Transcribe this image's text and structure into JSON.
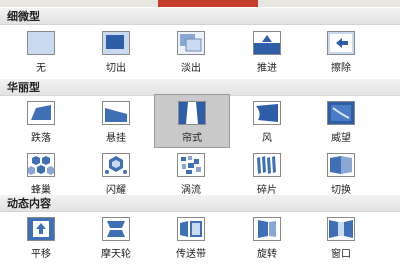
{
  "sections": [
    {
      "title": "细微型",
      "items": [
        {
          "label": "无",
          "icon": "none-transition-icon"
        },
        {
          "label": "切出",
          "icon": "cut-transition-icon"
        },
        {
          "label": "淡出",
          "icon": "fade-transition-icon"
        },
        {
          "label": "推进",
          "icon": "push-transition-icon"
        },
        {
          "label": "擦除",
          "icon": "wipe-transition-icon"
        }
      ]
    },
    {
      "title": "华丽型",
      "items": [
        {
          "label": "跌落",
          "icon": "fall-over-transition-icon"
        },
        {
          "label": "悬挂",
          "icon": "drape-transition-icon"
        },
        {
          "label": "帘式",
          "icon": "curtains-transition-icon",
          "selected": true
        },
        {
          "label": "风",
          "icon": "wind-transition-icon"
        },
        {
          "label": "威望",
          "icon": "prestige-transition-icon"
        },
        {
          "label": "蜂巢",
          "icon": "honeycomb-transition-icon"
        },
        {
          "label": "闪耀",
          "icon": "glitter-transition-icon"
        },
        {
          "label": "涡流",
          "icon": "vortex-transition-icon"
        },
        {
          "label": "碎片",
          "icon": "shred-transition-icon"
        },
        {
          "label": "切换",
          "icon": "switch-transition-icon"
        }
      ]
    },
    {
      "title": "动态内容",
      "items": [
        {
          "label": "平移",
          "icon": "pan-transition-icon"
        },
        {
          "label": "摩天轮",
          "icon": "ferris-wheel-transition-icon"
        },
        {
          "label": "传送带",
          "icon": "conveyor-transition-icon"
        },
        {
          "label": "旋转",
          "icon": "rotate-transition-icon"
        },
        {
          "label": "窗口",
          "icon": "window-transition-icon"
        }
      ]
    }
  ],
  "colors": {
    "thumb_blue": "#3f6fb5",
    "thumb_light": "#c9d9ef",
    "selected_bg": "#c9c9c9",
    "header_bg": "#ececec"
  }
}
